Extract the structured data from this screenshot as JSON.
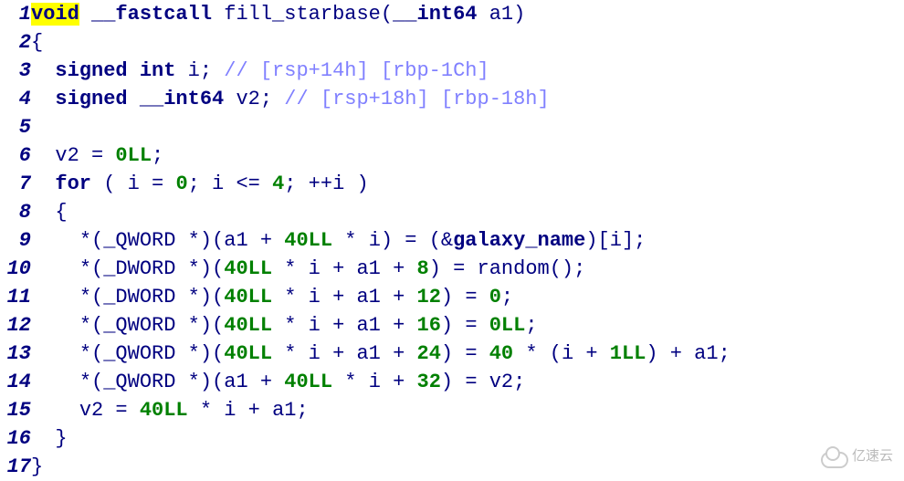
{
  "watermark": "亿速云",
  "code": {
    "lines": [
      {
        "n": 1,
        "tokens": [
          {
            "t": "void",
            "c": "tok-hl"
          },
          {
            "t": " ",
            "c": ""
          },
          {
            "t": "__fastcall",
            "c": "tok-kw"
          },
          {
            "t": " ",
            "c": ""
          },
          {
            "t": "fill_starbase",
            "c": "tok-fn"
          },
          {
            "t": "(",
            "c": "tok-punc"
          },
          {
            "t": "__int64",
            "c": "tok-kw"
          },
          {
            "t": " ",
            "c": ""
          },
          {
            "t": "a1",
            "c": "tok-id"
          },
          {
            "t": ")",
            "c": "tok-punc"
          }
        ]
      },
      {
        "n": 2,
        "tokens": [
          {
            "t": "{",
            "c": "tok-punc"
          }
        ]
      },
      {
        "n": 3,
        "tokens": [
          {
            "t": "  ",
            "c": ""
          },
          {
            "t": "signed",
            "c": "tok-kw"
          },
          {
            "t": " ",
            "c": ""
          },
          {
            "t": "int",
            "c": "tok-kw"
          },
          {
            "t": " ",
            "c": ""
          },
          {
            "t": "i",
            "c": "tok-id"
          },
          {
            "t": ";",
            "c": "tok-punc"
          },
          {
            "t": " ",
            "c": ""
          },
          {
            "t": "// [rsp+14h] [rbp-1Ch]",
            "c": "tok-cmt"
          }
        ]
      },
      {
        "n": 4,
        "tokens": [
          {
            "t": "  ",
            "c": ""
          },
          {
            "t": "signed",
            "c": "tok-kw"
          },
          {
            "t": " ",
            "c": ""
          },
          {
            "t": "__int64",
            "c": "tok-kw"
          },
          {
            "t": " ",
            "c": ""
          },
          {
            "t": "v2",
            "c": "tok-id"
          },
          {
            "t": ";",
            "c": "tok-punc"
          },
          {
            "t": " ",
            "c": ""
          },
          {
            "t": "// [rsp+18h] [rbp-18h]",
            "c": "tok-cmt"
          }
        ]
      },
      {
        "n": 5,
        "tokens": [
          {
            "t": " ",
            "c": ""
          }
        ]
      },
      {
        "n": 6,
        "tokens": [
          {
            "t": "  ",
            "c": ""
          },
          {
            "t": "v2",
            "c": "tok-id"
          },
          {
            "t": " ",
            "c": ""
          },
          {
            "t": "=",
            "c": "tok-punc"
          },
          {
            "t": " ",
            "c": ""
          },
          {
            "t": "0LL",
            "c": "tok-num"
          },
          {
            "t": ";",
            "c": "tok-punc"
          }
        ]
      },
      {
        "n": 7,
        "tokens": [
          {
            "t": "  ",
            "c": ""
          },
          {
            "t": "for",
            "c": "tok-kw"
          },
          {
            "t": " ",
            "c": ""
          },
          {
            "t": "(",
            "c": "tok-punc"
          },
          {
            "t": " ",
            "c": ""
          },
          {
            "t": "i",
            "c": "tok-id"
          },
          {
            "t": " ",
            "c": ""
          },
          {
            "t": "=",
            "c": "tok-punc"
          },
          {
            "t": " ",
            "c": ""
          },
          {
            "t": "0",
            "c": "tok-num"
          },
          {
            "t": ";",
            "c": "tok-punc"
          },
          {
            "t": " ",
            "c": ""
          },
          {
            "t": "i",
            "c": "tok-id"
          },
          {
            "t": " ",
            "c": ""
          },
          {
            "t": "<=",
            "c": "tok-punc"
          },
          {
            "t": " ",
            "c": ""
          },
          {
            "t": "4",
            "c": "tok-num"
          },
          {
            "t": ";",
            "c": "tok-punc"
          },
          {
            "t": " ",
            "c": ""
          },
          {
            "t": "++",
            "c": "tok-punc"
          },
          {
            "t": "i",
            "c": "tok-id"
          },
          {
            "t": " ",
            "c": ""
          },
          {
            "t": ")",
            "c": "tok-punc"
          }
        ]
      },
      {
        "n": 8,
        "tokens": [
          {
            "t": "  ",
            "c": ""
          },
          {
            "t": "{",
            "c": "tok-punc"
          }
        ]
      },
      {
        "n": 9,
        "tokens": [
          {
            "t": "    ",
            "c": ""
          },
          {
            "t": "*(",
            "c": "tok-punc"
          },
          {
            "t": "_QWORD",
            "c": "tok-id"
          },
          {
            "t": " ",
            "c": ""
          },
          {
            "t": "*)(",
            "c": "tok-punc"
          },
          {
            "t": "a1",
            "c": "tok-id"
          },
          {
            "t": " ",
            "c": ""
          },
          {
            "t": "+",
            "c": "tok-punc"
          },
          {
            "t": " ",
            "c": ""
          },
          {
            "t": "40LL",
            "c": "tok-num"
          },
          {
            "t": " ",
            "c": ""
          },
          {
            "t": "*",
            "c": "tok-punc"
          },
          {
            "t": " ",
            "c": ""
          },
          {
            "t": "i",
            "c": "tok-id"
          },
          {
            "t": ")",
            "c": "tok-punc"
          },
          {
            "t": " ",
            "c": ""
          },
          {
            "t": "=",
            "c": "tok-punc"
          },
          {
            "t": " ",
            "c": ""
          },
          {
            "t": "(&",
            "c": "tok-punc"
          },
          {
            "t": "galaxy_name",
            "c": "tok-kw"
          },
          {
            "t": ")[",
            "c": "tok-punc"
          },
          {
            "t": "i",
            "c": "tok-id"
          },
          {
            "t": "];",
            "c": "tok-punc"
          }
        ]
      },
      {
        "n": 10,
        "tokens": [
          {
            "t": "    ",
            "c": ""
          },
          {
            "t": "*(",
            "c": "tok-punc"
          },
          {
            "t": "_DWORD",
            "c": "tok-id"
          },
          {
            "t": " ",
            "c": ""
          },
          {
            "t": "*)(",
            "c": "tok-punc"
          },
          {
            "t": "40LL",
            "c": "tok-num"
          },
          {
            "t": " ",
            "c": ""
          },
          {
            "t": "*",
            "c": "tok-punc"
          },
          {
            "t": " ",
            "c": ""
          },
          {
            "t": "i",
            "c": "tok-id"
          },
          {
            "t": " ",
            "c": ""
          },
          {
            "t": "+",
            "c": "tok-punc"
          },
          {
            "t": " ",
            "c": ""
          },
          {
            "t": "a1",
            "c": "tok-id"
          },
          {
            "t": " ",
            "c": ""
          },
          {
            "t": "+",
            "c": "tok-punc"
          },
          {
            "t": " ",
            "c": ""
          },
          {
            "t": "8",
            "c": "tok-num"
          },
          {
            "t": ")",
            "c": "tok-punc"
          },
          {
            "t": " ",
            "c": ""
          },
          {
            "t": "=",
            "c": "tok-punc"
          },
          {
            "t": " ",
            "c": ""
          },
          {
            "t": "random",
            "c": "tok-fn"
          },
          {
            "t": "();",
            "c": "tok-punc"
          }
        ]
      },
      {
        "n": 11,
        "tokens": [
          {
            "t": "    ",
            "c": ""
          },
          {
            "t": "*(",
            "c": "tok-punc"
          },
          {
            "t": "_DWORD",
            "c": "tok-id"
          },
          {
            "t": " ",
            "c": ""
          },
          {
            "t": "*)(",
            "c": "tok-punc"
          },
          {
            "t": "40LL",
            "c": "tok-num"
          },
          {
            "t": " ",
            "c": ""
          },
          {
            "t": "*",
            "c": "tok-punc"
          },
          {
            "t": " ",
            "c": ""
          },
          {
            "t": "i",
            "c": "tok-id"
          },
          {
            "t": " ",
            "c": ""
          },
          {
            "t": "+",
            "c": "tok-punc"
          },
          {
            "t": " ",
            "c": ""
          },
          {
            "t": "a1",
            "c": "tok-id"
          },
          {
            "t": " ",
            "c": ""
          },
          {
            "t": "+",
            "c": "tok-punc"
          },
          {
            "t": " ",
            "c": ""
          },
          {
            "t": "12",
            "c": "tok-num"
          },
          {
            "t": ")",
            "c": "tok-punc"
          },
          {
            "t": " ",
            "c": ""
          },
          {
            "t": "=",
            "c": "tok-punc"
          },
          {
            "t": " ",
            "c": ""
          },
          {
            "t": "0",
            "c": "tok-num"
          },
          {
            "t": ";",
            "c": "tok-punc"
          }
        ]
      },
      {
        "n": 12,
        "tokens": [
          {
            "t": "    ",
            "c": ""
          },
          {
            "t": "*(",
            "c": "tok-punc"
          },
          {
            "t": "_QWORD",
            "c": "tok-id"
          },
          {
            "t": " ",
            "c": ""
          },
          {
            "t": "*)(",
            "c": "tok-punc"
          },
          {
            "t": "40LL",
            "c": "tok-num"
          },
          {
            "t": " ",
            "c": ""
          },
          {
            "t": "*",
            "c": "tok-punc"
          },
          {
            "t": " ",
            "c": ""
          },
          {
            "t": "i",
            "c": "tok-id"
          },
          {
            "t": " ",
            "c": ""
          },
          {
            "t": "+",
            "c": "tok-punc"
          },
          {
            "t": " ",
            "c": ""
          },
          {
            "t": "a1",
            "c": "tok-id"
          },
          {
            "t": " ",
            "c": ""
          },
          {
            "t": "+",
            "c": "tok-punc"
          },
          {
            "t": " ",
            "c": ""
          },
          {
            "t": "16",
            "c": "tok-num"
          },
          {
            "t": ")",
            "c": "tok-punc"
          },
          {
            "t": " ",
            "c": ""
          },
          {
            "t": "=",
            "c": "tok-punc"
          },
          {
            "t": " ",
            "c": ""
          },
          {
            "t": "0LL",
            "c": "tok-num"
          },
          {
            "t": ";",
            "c": "tok-punc"
          }
        ]
      },
      {
        "n": 13,
        "tokens": [
          {
            "t": "    ",
            "c": ""
          },
          {
            "t": "*(",
            "c": "tok-punc"
          },
          {
            "t": "_QWORD",
            "c": "tok-id"
          },
          {
            "t": " ",
            "c": ""
          },
          {
            "t": "*)(",
            "c": "tok-punc"
          },
          {
            "t": "40LL",
            "c": "tok-num"
          },
          {
            "t": " ",
            "c": ""
          },
          {
            "t": "*",
            "c": "tok-punc"
          },
          {
            "t": " ",
            "c": ""
          },
          {
            "t": "i",
            "c": "tok-id"
          },
          {
            "t": " ",
            "c": ""
          },
          {
            "t": "+",
            "c": "tok-punc"
          },
          {
            "t": " ",
            "c": ""
          },
          {
            "t": "a1",
            "c": "tok-id"
          },
          {
            "t": " ",
            "c": ""
          },
          {
            "t": "+",
            "c": "tok-punc"
          },
          {
            "t": " ",
            "c": ""
          },
          {
            "t": "24",
            "c": "tok-num"
          },
          {
            "t": ")",
            "c": "tok-punc"
          },
          {
            "t": " ",
            "c": ""
          },
          {
            "t": "=",
            "c": "tok-punc"
          },
          {
            "t": " ",
            "c": ""
          },
          {
            "t": "40",
            "c": "tok-num"
          },
          {
            "t": " ",
            "c": ""
          },
          {
            "t": "*",
            "c": "tok-punc"
          },
          {
            "t": " ",
            "c": ""
          },
          {
            "t": "(",
            "c": "tok-punc"
          },
          {
            "t": "i",
            "c": "tok-id"
          },
          {
            "t": " ",
            "c": ""
          },
          {
            "t": "+",
            "c": "tok-punc"
          },
          {
            "t": " ",
            "c": ""
          },
          {
            "t": "1LL",
            "c": "tok-num"
          },
          {
            "t": ")",
            "c": "tok-punc"
          },
          {
            "t": " ",
            "c": ""
          },
          {
            "t": "+",
            "c": "tok-punc"
          },
          {
            "t": " ",
            "c": ""
          },
          {
            "t": "a1",
            "c": "tok-id"
          },
          {
            "t": ";",
            "c": "tok-punc"
          }
        ]
      },
      {
        "n": 14,
        "tokens": [
          {
            "t": "    ",
            "c": ""
          },
          {
            "t": "*(",
            "c": "tok-punc"
          },
          {
            "t": "_QWORD",
            "c": "tok-id"
          },
          {
            "t": " ",
            "c": ""
          },
          {
            "t": "*)(",
            "c": "tok-punc"
          },
          {
            "t": "a1",
            "c": "tok-id"
          },
          {
            "t": " ",
            "c": ""
          },
          {
            "t": "+",
            "c": "tok-punc"
          },
          {
            "t": " ",
            "c": ""
          },
          {
            "t": "40LL",
            "c": "tok-num"
          },
          {
            "t": " ",
            "c": ""
          },
          {
            "t": "*",
            "c": "tok-punc"
          },
          {
            "t": " ",
            "c": ""
          },
          {
            "t": "i",
            "c": "tok-id"
          },
          {
            "t": " ",
            "c": ""
          },
          {
            "t": "+",
            "c": "tok-punc"
          },
          {
            "t": " ",
            "c": ""
          },
          {
            "t": "32",
            "c": "tok-num"
          },
          {
            "t": ")",
            "c": "tok-punc"
          },
          {
            "t": " ",
            "c": ""
          },
          {
            "t": "=",
            "c": "tok-punc"
          },
          {
            "t": " ",
            "c": ""
          },
          {
            "t": "v2",
            "c": "tok-id"
          },
          {
            "t": ";",
            "c": "tok-punc"
          }
        ]
      },
      {
        "n": 15,
        "tokens": [
          {
            "t": "    ",
            "c": ""
          },
          {
            "t": "v2",
            "c": "tok-id"
          },
          {
            "t": " ",
            "c": ""
          },
          {
            "t": "=",
            "c": "tok-punc"
          },
          {
            "t": " ",
            "c": ""
          },
          {
            "t": "40LL",
            "c": "tok-num"
          },
          {
            "t": " ",
            "c": ""
          },
          {
            "t": "*",
            "c": "tok-punc"
          },
          {
            "t": " ",
            "c": ""
          },
          {
            "t": "i",
            "c": "tok-id"
          },
          {
            "t": " ",
            "c": ""
          },
          {
            "t": "+",
            "c": "tok-punc"
          },
          {
            "t": " ",
            "c": ""
          },
          {
            "t": "a1",
            "c": "tok-id"
          },
          {
            "t": ";",
            "c": "tok-punc"
          }
        ]
      },
      {
        "n": 16,
        "tokens": [
          {
            "t": "  ",
            "c": ""
          },
          {
            "t": "}",
            "c": "tok-punc"
          }
        ]
      },
      {
        "n": 17,
        "tokens": [
          {
            "t": "}",
            "c": "tok-punc"
          }
        ]
      }
    ]
  }
}
